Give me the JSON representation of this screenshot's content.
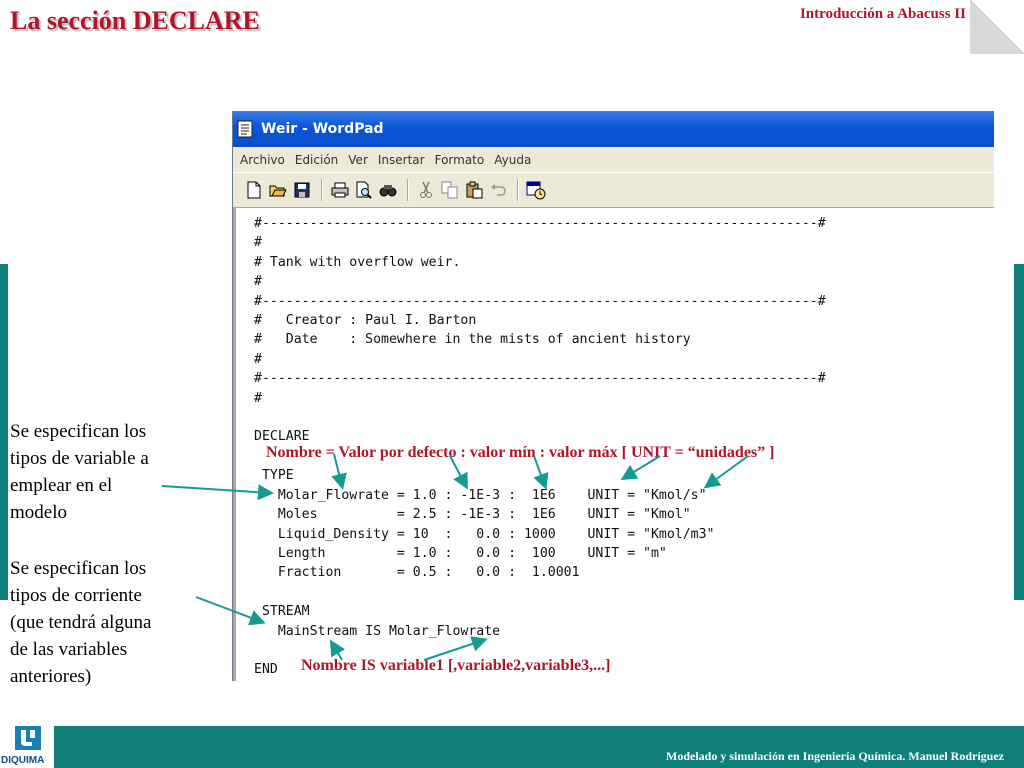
{
  "slide": {
    "title": "La sección DECLARE",
    "course": "Introducción a Abacuss II",
    "footer": "Modelado y simulación en Ingeniería Química.  Manuel Rodríguez",
    "logo_text": "DIQUIMA"
  },
  "window": {
    "title": "Weir - WordPad",
    "menu": [
      "Archivo",
      "Edición",
      "Ver",
      "Insertar",
      "Formato",
      "Ayuda"
    ],
    "toolbar_icons": [
      "new-icon",
      "open-icon",
      "save-icon",
      "print-icon",
      "print-preview-icon",
      "find-icon",
      "cut-icon",
      "copy-icon",
      "paste-icon",
      "undo-icon",
      "date-time-icon"
    ]
  },
  "document": {
    "lines": [
      "#----------------------------------------------------------------------#",
      "#",
      "# Tank with overflow weir.",
      "#",
      "#----------------------------------------------------------------------#",
      "#   Creator : Paul I. Barton",
      "#   Date    : Somewhere in the mists of ancient history",
      "#",
      "#----------------------------------------------------------------------#",
      "#",
      "",
      "DECLARE",
      "",
      " TYPE",
      "   Molar_Flowrate = 1.0 : -1E-3 :  1E6    UNIT = \"Kmol/s\"",
      "   Moles          = 2.5 : -1E-3 :  1E6    UNIT = \"Kmol\"",
      "   Liquid_Density = 10  :   0.0 : 1000    UNIT = \"Kmol/m3\"",
      "   Length         = 1.0 :   0.0 :  100    UNIT = \"m\"",
      "   Fraction       = 0.5 :   0.0 :  1.0001",
      "",
      " STREAM",
      "   MainStream IS Molar_Flowrate",
      "",
      "END"
    ]
  },
  "annotations": {
    "type_syntax": "Nombre = Valor por defecto : valor mín : valor máx [ UNIT = “unidades” ]",
    "stream_syntax": "Nombre  IS variable1 [,variable2,variable3,...]",
    "type_note": [
      "Se especifican los",
      "tipos de variable a",
      "emplear en el",
      "modelo"
    ],
    "stream_note": [
      "Se especifican los",
      "tipos de corriente",
      "(que tendrá alguna",
      "de las variables",
      "anteriores)"
    ]
  },
  "colors": {
    "accent": "#b0152a",
    "teal": "#0f7f7a",
    "window_title": "#0a56d8",
    "chrome": "#ece9d8"
  }
}
